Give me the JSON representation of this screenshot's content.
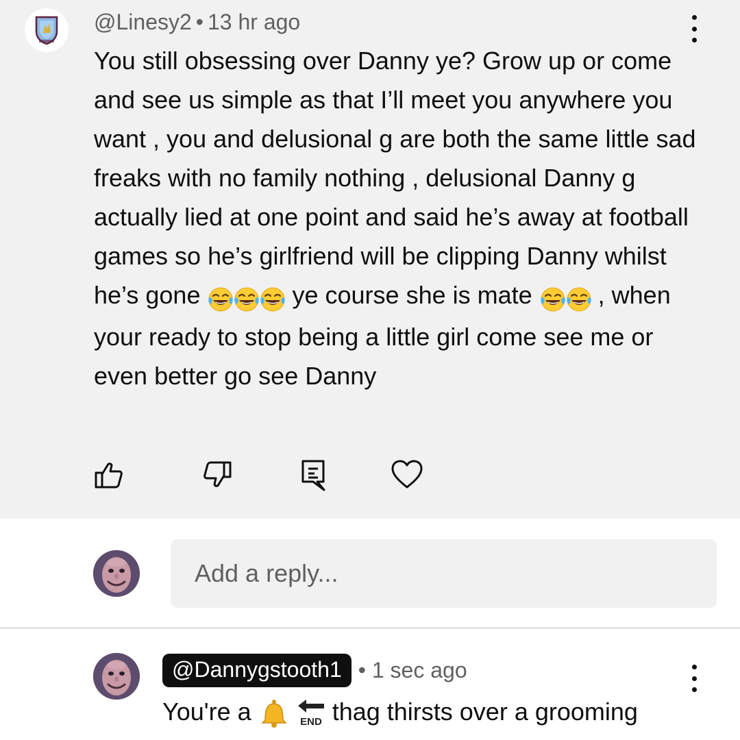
{
  "comment": {
    "username": "@Linesy2",
    "separator": "•",
    "time": "13 hr ago",
    "text_part1": "You still obsessing over Danny ye? Grow up or come and see us simple as that I’ll meet you anywhere you want , you and delusional g are both the same little sad freaks with no family nothing , delusional Danny g actually lied at one point and said he’s away at football games so he’s girlfriend will be clipping Danny whilst he’s gone ",
    "text_part2": " ye course she is mate ",
    "text_part3": " , when your ready to stop being a little girl come see me or even better go see Danny",
    "emoji_run1": "😂😂😂",
    "emoji_run2": "😂😂",
    "actions": [
      "like-icon",
      "dislike-icon",
      "reply-comment-icon",
      "heart-icon"
    ],
    "menu_icon": "more-vert-icon"
  },
  "reply_box": {
    "placeholder": "Add a reply..."
  },
  "reply": {
    "handle": "@Dannygstooth1",
    "separator": "•",
    "time": "1 sec ago",
    "text_after_emojis": " thag thirsts over a grooming",
    "emojis": [
      "🔔",
      "🔚"
    ],
    "menu_icon": "more-vert-icon"
  },
  "colors": {
    "panel_bg": "#f1f1f1",
    "text_primary": "#0f0f0f",
    "text_secondary": "#606060",
    "badge_bg": "#0f0f0f"
  }
}
